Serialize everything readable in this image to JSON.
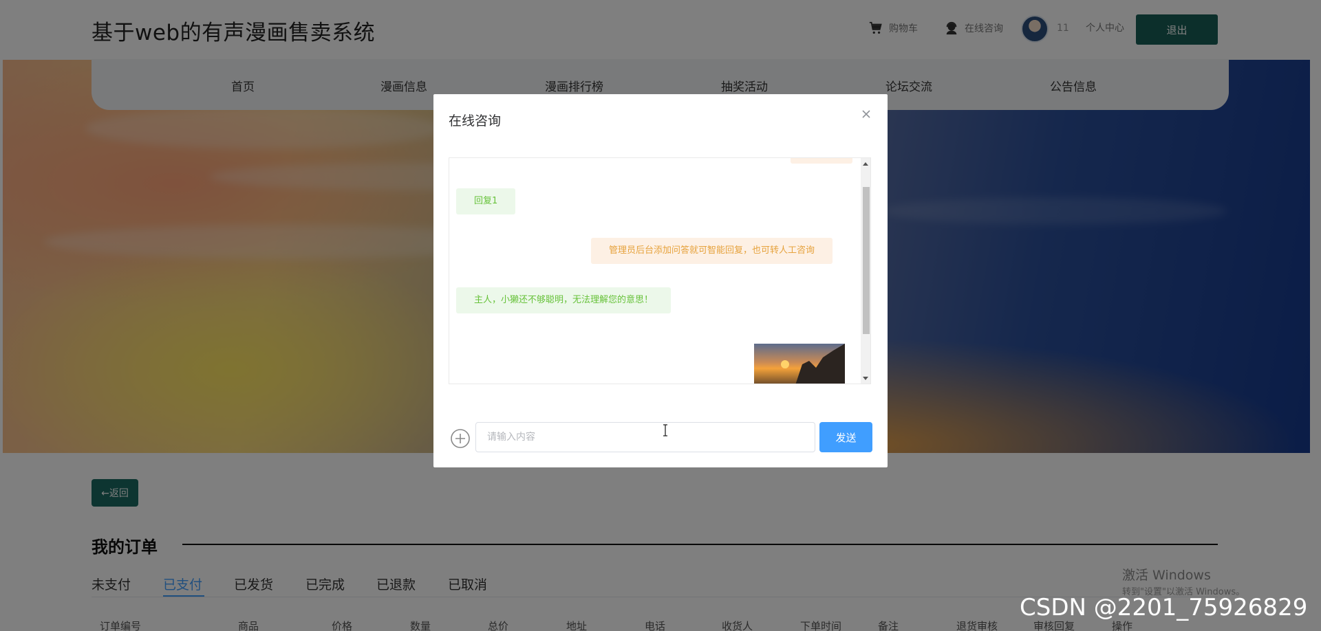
{
  "header": {
    "site_title": "基于web的有声漫画售卖系统",
    "cart_label": "购物车",
    "consult_label": "在线咨询",
    "user_number": "11",
    "profile_label": "个人中心",
    "logout_label": "退出"
  },
  "nav": {
    "items": [
      {
        "label": "首页"
      },
      {
        "label": "漫画信息"
      },
      {
        "label": "漫画排行榜"
      },
      {
        "label": "抽奖活动"
      },
      {
        "label": "论坛交流"
      },
      {
        "label": "公告信息"
      }
    ]
  },
  "back_label": "←返回",
  "orders": {
    "title": "我的订单",
    "tabs": [
      "未支付",
      "已支付",
      "已发货",
      "已完成",
      "已退款",
      "已取消"
    ],
    "active_tab": "已支付",
    "columns": [
      "订单编号",
      "商品",
      "价格",
      "数量",
      "总价",
      "地址",
      "电话",
      "收货人",
      "下单时间",
      "备注",
      "退货审核",
      "审核回复",
      "操作"
    ]
  },
  "dialog": {
    "title": "在线咨询",
    "messages": [
      {
        "side": "left",
        "text": "回复1"
      },
      {
        "side": "right",
        "text": "管理员后台添加问答就可智能回复，也可转人工咨询"
      },
      {
        "side": "left",
        "text": "主人，小獭还不够聪明，无法理解您的意思！"
      }
    ],
    "input_placeholder": "请输入内容",
    "send_label": "发送"
  },
  "watermarks": {
    "windows_line1": "激活 Windows",
    "windows_line2": "转到\"设置\"以激活 Windows。",
    "csdn": "CSDN @2201_75926829"
  },
  "colors": {
    "accent_dark": "#185f57",
    "primary": "#409eff",
    "bot_bubble": "#ecf8ea",
    "user_bubble": "#fdf0e4"
  }
}
